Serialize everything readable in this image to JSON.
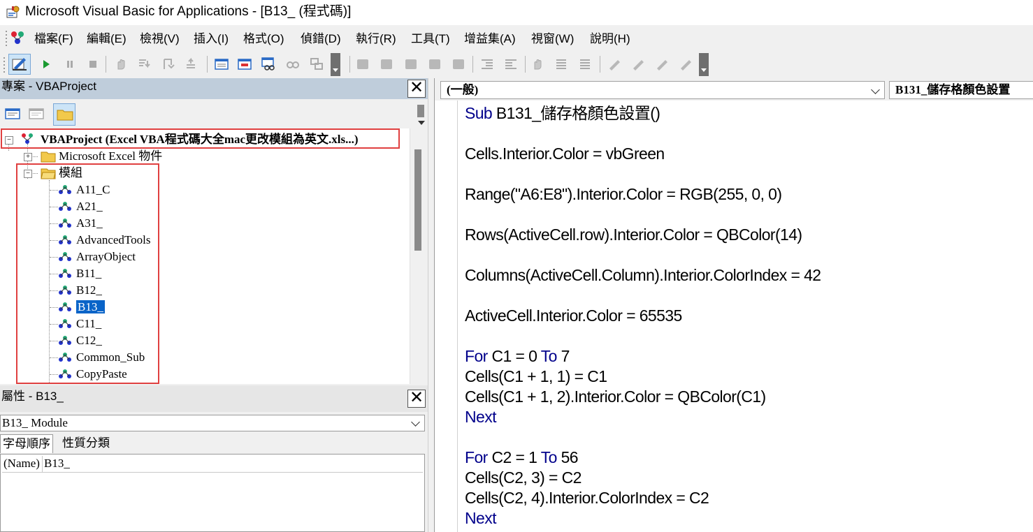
{
  "window": {
    "title": "Microsoft Visual Basic for Applications - [B13_ (程式碼)]"
  },
  "menu": {
    "items": [
      "檔案(F)",
      "編輯(E)",
      "檢視(V)",
      "插入(I)",
      "格式(O)",
      "偵錯(D)",
      "執行(R)",
      "工具(T)",
      "增益集(A)",
      "視窗(W)",
      "說明(H)"
    ]
  },
  "toolbar": {
    "icons": [
      "design-mode-icon",
      "run-icon",
      "break-icon",
      "reset-icon",
      "toggle-breakpoint-icon",
      "step-into-icon",
      "step-over-icon",
      "step-out-icon",
      "locals-window-icon",
      "immediate-window-icon",
      "watch-window-icon",
      "quick-watch-icon",
      "call-stack-icon",
      "list-properties-icon",
      "list-constants-icon",
      "quick-info-icon",
      "parameter-info-icon",
      "complete-word-icon",
      "indent-icon",
      "outdent-icon",
      "toggle-breakpoint2-icon",
      "comment-block-icon",
      "uncomment-block-icon",
      "toggle-bookmark-icon",
      "next-bookmark-icon",
      "previous-bookmark-icon",
      "clear-bookmarks-icon"
    ]
  },
  "project": {
    "title": "專案 - VBAProject",
    "root": "VBAProject (Excel VBA程式碼大全mac更改模組為英文.xls...)",
    "excel_objects": "Microsoft Excel 物件",
    "modules_folder": "模組",
    "modules": [
      "A11_C",
      "A21_",
      "A31_",
      "AdvancedTools",
      "ArrayObject",
      "B11_",
      "B12_",
      "B13_",
      "C11_",
      "C12_",
      "Common_Sub",
      "CopyPaste"
    ],
    "selected": "B13_"
  },
  "properties": {
    "title": "屬性 - B13_",
    "object": "B13_  Module",
    "tabs": [
      "字母順序",
      "性質分類"
    ],
    "rows": [
      {
        "name": "(Name)",
        "value": "B13_"
      }
    ]
  },
  "code": {
    "object_combo": "(一般)",
    "proc_combo": "B131_儲存格顏色設置",
    "lines": [
      {
        "kw": "Sub",
        "rest": " B131_儲存格顏色設置()"
      },
      {
        "kw": "",
        "rest": ""
      },
      {
        "kw": "",
        "rest": "Cells.Interior.Color = vbGreen"
      },
      {
        "kw": "",
        "rest": ""
      },
      {
        "kw": "",
        "rest": "Range(\"A6:E8\").Interior.Color = RGB(255, 0, 0)"
      },
      {
        "kw": "",
        "rest": ""
      },
      {
        "kw": "",
        "rest": "Rows(ActiveCell.row).Interior.Color = QBColor(14)"
      },
      {
        "kw": "",
        "rest": ""
      },
      {
        "kw": "",
        "rest": "Columns(ActiveCell.Column).Interior.ColorIndex = 42"
      },
      {
        "kw": "",
        "rest": ""
      },
      {
        "kw": "",
        "rest": "ActiveCell.Interior.Color = 65535"
      },
      {
        "kw": "",
        "rest": ""
      },
      {
        "kw": "For",
        "rest": " C1 = 0 ",
        "kw2": "To",
        "rest2": " 7"
      },
      {
        "kw": "",
        "rest": "Cells(C1 + 1, 1) = C1"
      },
      {
        "kw": "",
        "rest": "Cells(C1 + 1, 2).Interior.Color = QBColor(C1)"
      },
      {
        "kw": "Next",
        "rest": ""
      },
      {
        "kw": "",
        "rest": ""
      },
      {
        "kw": "For",
        "rest": " C2 = 1 ",
        "kw2": "To",
        "rest2": " 56"
      },
      {
        "kw": "",
        "rest": "Cells(C2, 3) = C2"
      },
      {
        "kw": "",
        "rest": "Cells(C2, 4).Interior.ColorIndex = C2"
      },
      {
        "kw": "Next",
        "rest": ""
      }
    ]
  },
  "colors": {
    "keyword": "#00008b",
    "selection": "#0a64c8",
    "highlight_box": "#e04040",
    "pane_title": "#bfcddb"
  }
}
